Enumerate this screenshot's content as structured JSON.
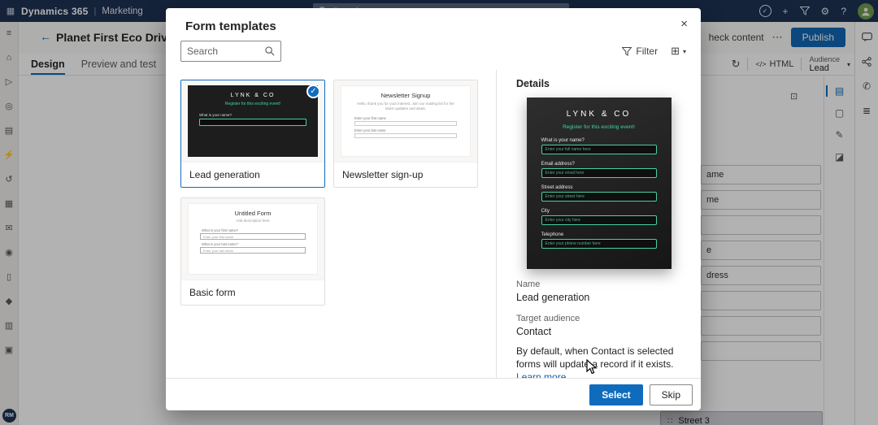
{
  "topbar": {
    "brand": "Dynamics 365",
    "app": "Marketing",
    "search_placeholder": "Search"
  },
  "icons": {
    "waffle": "▦",
    "check": "✓",
    "plus": "+",
    "gear": "⚙",
    "help": "?",
    "back": "←",
    "more": "⋯",
    "close": "×",
    "chevron_down": "▾",
    "grid_view": "⊞",
    "refresh": "↻",
    "code": "</>",
    "phone": "✆",
    "list": "≣",
    "expand": "⊡",
    "grip": "∷"
  },
  "left_rail": [
    {
      "name": "menu",
      "glyph": "≡"
    },
    {
      "name": "home",
      "glyph": "⌂"
    },
    {
      "name": "get-started",
      "glyph": "▷"
    },
    {
      "name": "customers",
      "glyph": "◎"
    },
    {
      "name": "analytics",
      "glyph": "▤"
    },
    {
      "name": "journeys",
      "glyph": "⚡"
    },
    {
      "name": "history",
      "glyph": "↺"
    },
    {
      "name": "segments",
      "glyph": "▦"
    },
    {
      "name": "email",
      "glyph": "✉"
    },
    {
      "name": "campaigns",
      "glyph": "◉"
    },
    {
      "name": "mobile",
      "glyph": "▯"
    },
    {
      "name": "assets",
      "glyph": "◆"
    },
    {
      "name": "reports",
      "glyph": "▥"
    },
    {
      "name": "settings-area",
      "glyph": "▣"
    }
  ],
  "panel_icons": [
    {
      "name": "layout-panel",
      "glyph": "▤"
    },
    {
      "name": "properties-panel",
      "glyph": "▢"
    },
    {
      "name": "styles-panel",
      "glyph": "✎"
    },
    {
      "name": "preview-panel",
      "glyph": "◪"
    }
  ],
  "page": {
    "title": "Planet First Eco Drive Re",
    "tabs": [
      {
        "label": "Design"
      },
      {
        "label": "Preview and test"
      }
    ],
    "actions": {
      "check_content_fragment": "heck content",
      "publish": "Publish",
      "html_chip": "HTML",
      "audience_label": "Audience",
      "audience_value": "Lead"
    },
    "editor": {
      "field_fragments": [
        "ame",
        "me",
        "",
        "e",
        "dress",
        "",
        "",
        ""
      ],
      "dragged_item": "Street 3"
    },
    "user_initials": "RM"
  },
  "modal": {
    "title": "Form templates",
    "search_placeholder": "Search",
    "filter_label": "Filter",
    "cards": [
      {
        "label": "Lead generation",
        "selected": true
      },
      {
        "label": "Newsletter sign-up",
        "selected": false
      },
      {
        "label": "Basic form",
        "selected": false
      }
    ],
    "details": {
      "heading": "Details",
      "name_label": "Name",
      "name_value": "Lead generation",
      "target_label": "Target audience",
      "target_value": "Contact",
      "description": "By default, when Contact is selected forms will update a record if it exists.",
      "learn_more": "Learn more"
    },
    "footer": {
      "select": "Select",
      "skip": "Skip"
    }
  },
  "lead_form": {
    "logo": "LYNK & CO",
    "tagline": "Register for this exciting event!",
    "fields": [
      {
        "label": "What is your name?",
        "placeholder": "Enter your full name here"
      },
      {
        "label": "Email address?",
        "placeholder": "Enter your email here"
      },
      {
        "label": "Street address",
        "placeholder": "Enter your street here"
      },
      {
        "label": "City",
        "placeholder": "Enter your city here"
      },
      {
        "label": "Telephone",
        "placeholder": "Enter your phone number here"
      }
    ]
  },
  "newsletter_form": {
    "title": "Newsletter Signup",
    "body": "Hello, thank you for your interest. Join our mailing list for the latest updates and deals.",
    "fields": [
      {
        "label": "Enter your first name"
      },
      {
        "label": "Enter your last name"
      }
    ]
  },
  "basic_form": {
    "title": "Untitled Form",
    "subtitle": "Add description here",
    "fields": [
      {
        "label": "What is your first name?",
        "placeholder": "Enter your first name"
      },
      {
        "label": "What is your last name?",
        "placeholder": "Enter your last name"
      }
    ]
  },
  "colors": {
    "accent": "#0f6cbd",
    "topbar": "#1e3154",
    "form_green": "#3fd6a0"
  }
}
